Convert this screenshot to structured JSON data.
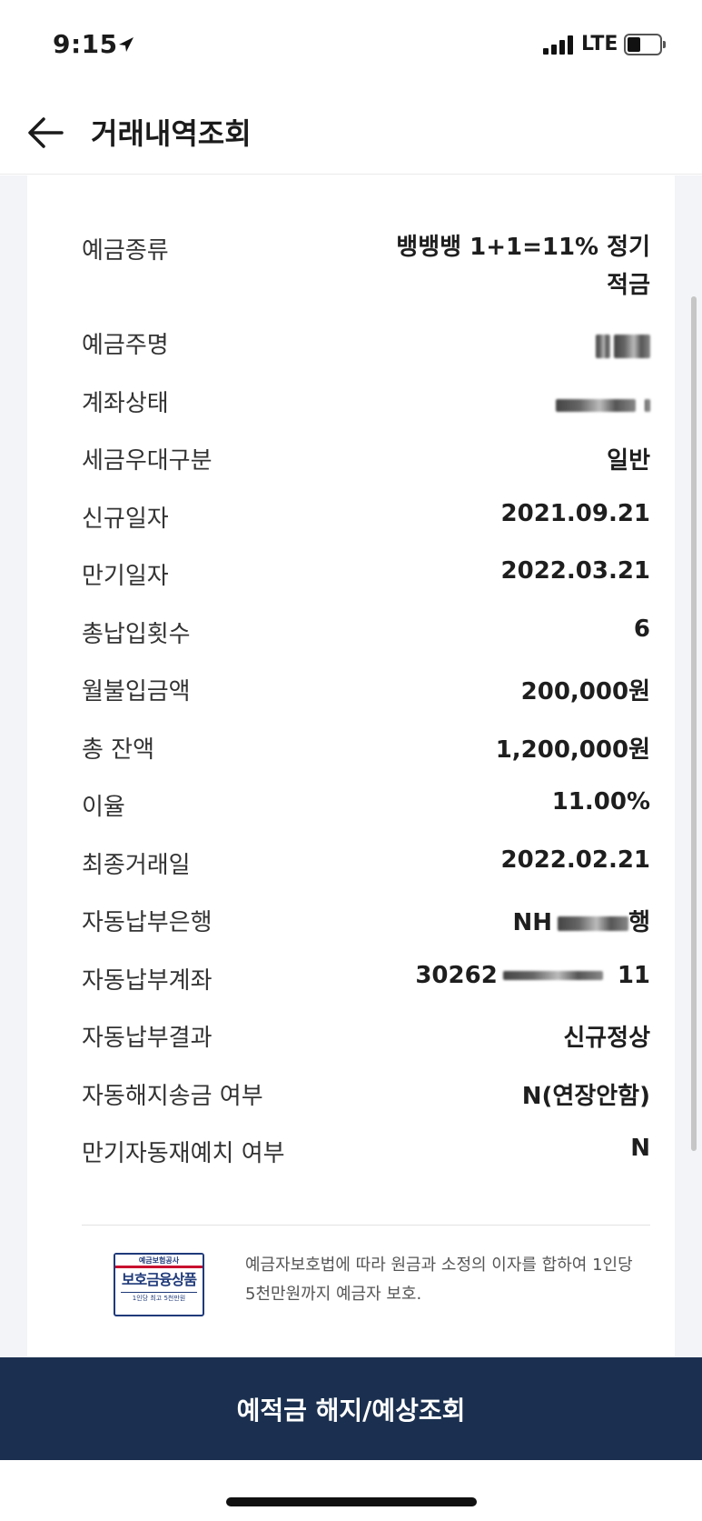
{
  "status_bar": {
    "time": "9:15",
    "network": "LTE"
  },
  "header": {
    "title": "거래내역조회",
    "back_icon": "arrow-left-icon"
  },
  "details": [
    {
      "label": "예금종류",
      "value": "뱅뱅뱅 1+1=11% 정기적금"
    },
    {
      "label": "예금주명",
      "value": ""
    },
    {
      "label": "계좌상태",
      "value": ""
    },
    {
      "label": "세금우대구분",
      "value": "일반"
    },
    {
      "label": "신규일자",
      "value": "2021.09.21"
    },
    {
      "label": "만기일자",
      "value": "2022.03.21"
    },
    {
      "label": "총납입횟수",
      "value": "6"
    },
    {
      "label": "월불입금액",
      "value": "200,000원"
    },
    {
      "label": "총 잔액",
      "value": "1,200,000원"
    },
    {
      "label": "이율",
      "value": "11.00%"
    },
    {
      "label": "최종거래일",
      "value": "2022.02.21"
    },
    {
      "label": "자동납부은행",
      "value_prefix": "NH",
      "value_suffix": "행"
    },
    {
      "label": "자동납부계좌",
      "value_prefix": "30262",
      "value_suffix": "11"
    },
    {
      "label": "자동납부결과",
      "value": "신규정상"
    },
    {
      "label": "자동해지송금 여부",
      "value": "N(연장안함)"
    },
    {
      "label": "만기자동재예치 여부",
      "value": "N"
    }
  ],
  "protection": {
    "badge_top": "예금보험공사",
    "badge_main": "보호금융상품",
    "badge_sub": "1인당 최고 5천만원",
    "text": "예금자보호법에 따라 원금과 소정의 이자를 합하여 1인당 5천만원까지 예금자 보호."
  },
  "action": {
    "label": "예적금 해지/예상조회"
  },
  "colors": {
    "action_bg": "#1b3050",
    "badge_blue": "#1f3a7a",
    "badge_red": "#c8102e",
    "page_bg": "#f3f4f7"
  }
}
